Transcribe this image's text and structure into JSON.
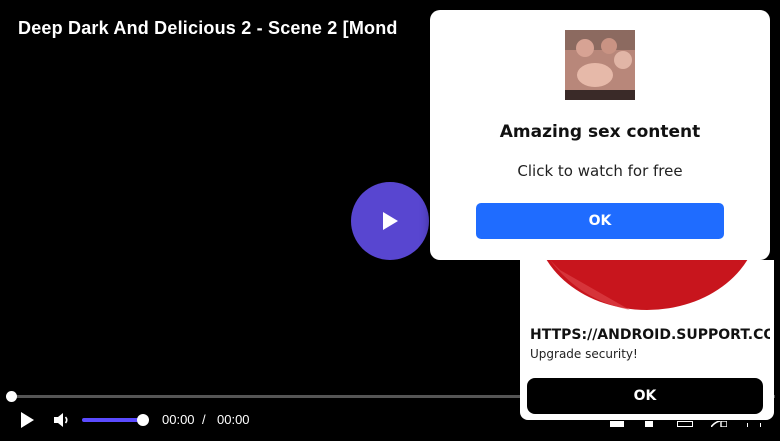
{
  "player": {
    "title": "Deep Dark And Delicious 2 - Scene 2 [Mond",
    "current_time": "00:00",
    "separator": "/",
    "duration": "00:00",
    "progress_fraction": 0,
    "volume_fraction": 1,
    "accent_color": "#5846d0",
    "icons": [
      "play-icon",
      "volume-icon",
      "big-play-icon",
      "settings-icon",
      "pip-icon",
      "cast-icon",
      "fullscreen-icon"
    ]
  },
  "popup": {
    "heading": "Amazing sex content",
    "text": "Click to watch for free",
    "ok_label": "OK",
    "button_color": "#1f6cff"
  },
  "notification": {
    "url": "HTTPS://ANDROID.SUPPORT.CO...",
    "message": "Upgrade security!",
    "ok_label": "OK",
    "art_color": "#c8151d"
  }
}
